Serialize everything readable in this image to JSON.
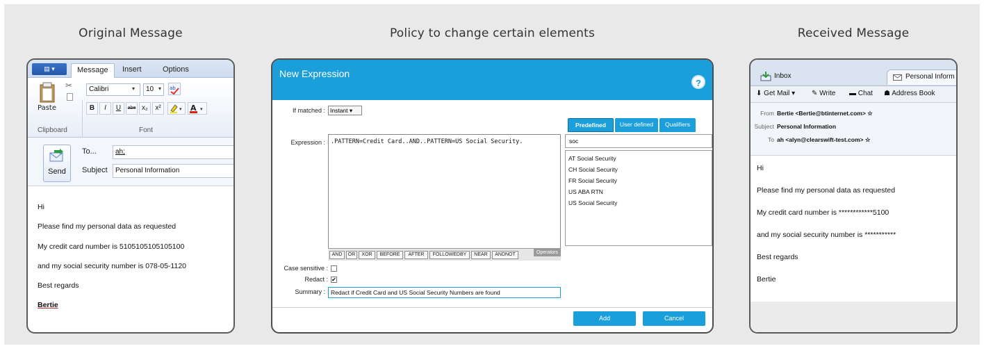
{
  "headings": {
    "original": "Original Message",
    "policy": "Policy to change certain elements",
    "received": "Received Message"
  },
  "outlook": {
    "tabs": [
      "Message",
      "Insert",
      "Options"
    ],
    "paste_label": "Paste",
    "clipboard_label": "Clipboard",
    "font_group_label": "Font",
    "font_name": "Calibri",
    "font_size": "10",
    "format_buttons": [
      "B",
      "I",
      "U",
      "abe",
      "x₂",
      "x²"
    ],
    "send_label": "Send",
    "to_label": "To...",
    "to_value": "ah;",
    "subject_label": "Subject",
    "subject_value": "Personal Information",
    "body": [
      "Hi",
      "Please find my personal data as requested",
      "My credit card number is 5105105105105100",
      "and my social security number is 078-05-1120",
      "Best regards",
      "Bertie"
    ]
  },
  "policy": {
    "title": "New Expression",
    "help": "?",
    "if_matched_label": "If matched :",
    "if_matched_value": "Instant ▾",
    "expression_label": "Expression :",
    "expression_value": ".PATTERN=Credit Card..AND..PATTERN=US Social Security.",
    "operators": [
      "AND",
      "OR",
      "XOR",
      "BEFORE",
      "AFTER",
      "FOLLOWEDBY",
      "NEAR",
      "ANDNOT"
    ],
    "operators_label": "Operators",
    "tabs": [
      "Predefined",
      "User defined",
      "Qualifiers"
    ],
    "search_value": "soc",
    "list_items": [
      "AT Social Security",
      "CH Social Security",
      "FR Social Security",
      "US ABA RTN",
      "US Social Security"
    ],
    "case_label": "Case sensitive :",
    "case_checked": "",
    "redact_label": "Redact :",
    "redact_checked": "✔",
    "summary_label": "Summary :",
    "summary_value": "Redact if Credit Card and US Social Security Numbers are found",
    "add_label": "Add",
    "cancel_label": "Cancel"
  },
  "received": {
    "tabs": [
      "Inbox",
      "Personal Inform"
    ],
    "toolbar": [
      "Get Mail",
      "Write",
      "Chat",
      "Address Book"
    ],
    "from_label": "From",
    "from_value": "Bertie <Bertie@btinternet.com> ☆",
    "subject_label": "Subject",
    "subject_value": "Personal Information",
    "to_label": "To",
    "to_value": "ah <alyn@clearswift-test.com> ☆",
    "body": [
      "Hi",
      "Please find my personal data as requested",
      "My credit card number is ************5100",
      "and my social security number is ***********",
      "Best regards",
      "Bertie"
    ]
  }
}
